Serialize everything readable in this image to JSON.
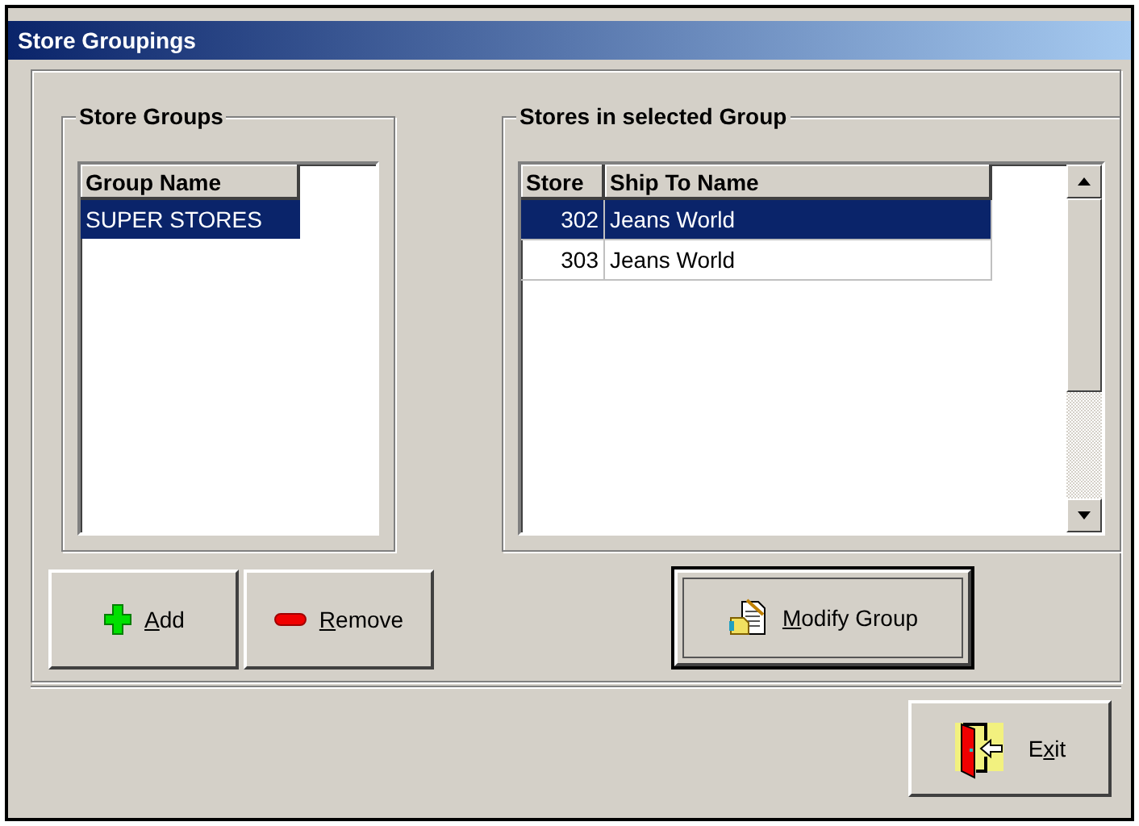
{
  "window": {
    "title": "Store Groupings"
  },
  "store_groups": {
    "title": "Store Groups",
    "columns": [
      "Group Name"
    ],
    "rows": [
      {
        "name": "SUPER STORES",
        "selected": true
      }
    ]
  },
  "stores": {
    "title": "Stores in selected Group",
    "columns": [
      "Store",
      "Ship To Name"
    ],
    "rows": [
      {
        "store": "302",
        "ship_to": "Jeans World",
        "selected": true
      },
      {
        "store": "303",
        "ship_to": "Jeans World",
        "selected": false
      }
    ]
  },
  "buttons": [
    {
      "kind": "add",
      "key": "A",
      "rest": "dd"
    },
    {
      "kind": "remove",
      "key": "R",
      "rest": "emove"
    },
    {
      "kind": "modify",
      "key": "M",
      "rest": "odify Group"
    },
    {
      "kind": "exit",
      "lead": "E",
      "key": "x",
      "rest": "it"
    }
  ]
}
